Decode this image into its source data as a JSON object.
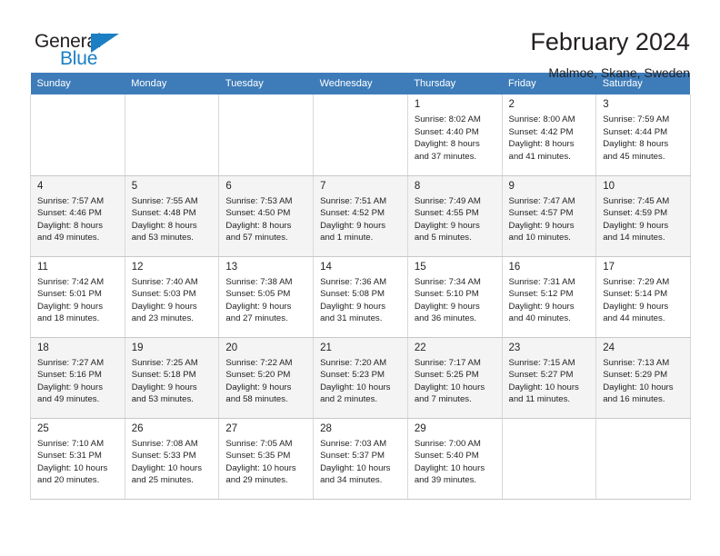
{
  "brand": {
    "name_part1": "General",
    "name_part2": "Blue",
    "mark_icon": "triangle-flag-icon",
    "accent_color": "#1c7fc4"
  },
  "header": {
    "title": "February 2024",
    "subtitle": "Malmoe, Skane, Sweden"
  },
  "calendar": {
    "header_bg": "#3e7cb9",
    "weekdays": [
      "Sunday",
      "Monday",
      "Tuesday",
      "Wednesday",
      "Thursday",
      "Friday",
      "Saturday"
    ],
    "weeks": [
      [
        {
          "day": "",
          "sunrise": "",
          "sunset": "",
          "daylight_line1": "",
          "daylight_line2": ""
        },
        {
          "day": "",
          "sunrise": "",
          "sunset": "",
          "daylight_line1": "",
          "daylight_line2": ""
        },
        {
          "day": "",
          "sunrise": "",
          "sunset": "",
          "daylight_line1": "",
          "daylight_line2": ""
        },
        {
          "day": "",
          "sunrise": "",
          "sunset": "",
          "daylight_line1": "",
          "daylight_line2": ""
        },
        {
          "day": "1",
          "sunrise": "Sunrise: 8:02 AM",
          "sunset": "Sunset: 4:40 PM",
          "daylight_line1": "Daylight: 8 hours",
          "daylight_line2": "and 37 minutes."
        },
        {
          "day": "2",
          "sunrise": "Sunrise: 8:00 AM",
          "sunset": "Sunset: 4:42 PM",
          "daylight_line1": "Daylight: 8 hours",
          "daylight_line2": "and 41 minutes."
        },
        {
          "day": "3",
          "sunrise": "Sunrise: 7:59 AM",
          "sunset": "Sunset: 4:44 PM",
          "daylight_line1": "Daylight: 8 hours",
          "daylight_line2": "and 45 minutes."
        }
      ],
      [
        {
          "day": "4",
          "sunrise": "Sunrise: 7:57 AM",
          "sunset": "Sunset: 4:46 PM",
          "daylight_line1": "Daylight: 8 hours",
          "daylight_line2": "and 49 minutes."
        },
        {
          "day": "5",
          "sunrise": "Sunrise: 7:55 AM",
          "sunset": "Sunset: 4:48 PM",
          "daylight_line1": "Daylight: 8 hours",
          "daylight_line2": "and 53 minutes."
        },
        {
          "day": "6",
          "sunrise": "Sunrise: 7:53 AM",
          "sunset": "Sunset: 4:50 PM",
          "daylight_line1": "Daylight: 8 hours",
          "daylight_line2": "and 57 minutes."
        },
        {
          "day": "7",
          "sunrise": "Sunrise: 7:51 AM",
          "sunset": "Sunset: 4:52 PM",
          "daylight_line1": "Daylight: 9 hours",
          "daylight_line2": "and 1 minute."
        },
        {
          "day": "8",
          "sunrise": "Sunrise: 7:49 AM",
          "sunset": "Sunset: 4:55 PM",
          "daylight_line1": "Daylight: 9 hours",
          "daylight_line2": "and 5 minutes."
        },
        {
          "day": "9",
          "sunrise": "Sunrise: 7:47 AM",
          "sunset": "Sunset: 4:57 PM",
          "daylight_line1": "Daylight: 9 hours",
          "daylight_line2": "and 10 minutes."
        },
        {
          "day": "10",
          "sunrise": "Sunrise: 7:45 AM",
          "sunset": "Sunset: 4:59 PM",
          "daylight_line1": "Daylight: 9 hours",
          "daylight_line2": "and 14 minutes."
        }
      ],
      [
        {
          "day": "11",
          "sunrise": "Sunrise: 7:42 AM",
          "sunset": "Sunset: 5:01 PM",
          "daylight_line1": "Daylight: 9 hours",
          "daylight_line2": "and 18 minutes."
        },
        {
          "day": "12",
          "sunrise": "Sunrise: 7:40 AM",
          "sunset": "Sunset: 5:03 PM",
          "daylight_line1": "Daylight: 9 hours",
          "daylight_line2": "and 23 minutes."
        },
        {
          "day": "13",
          "sunrise": "Sunrise: 7:38 AM",
          "sunset": "Sunset: 5:05 PM",
          "daylight_line1": "Daylight: 9 hours",
          "daylight_line2": "and 27 minutes."
        },
        {
          "day": "14",
          "sunrise": "Sunrise: 7:36 AM",
          "sunset": "Sunset: 5:08 PM",
          "daylight_line1": "Daylight: 9 hours",
          "daylight_line2": "and 31 minutes."
        },
        {
          "day": "15",
          "sunrise": "Sunrise: 7:34 AM",
          "sunset": "Sunset: 5:10 PM",
          "daylight_line1": "Daylight: 9 hours",
          "daylight_line2": "and 36 minutes."
        },
        {
          "day": "16",
          "sunrise": "Sunrise: 7:31 AM",
          "sunset": "Sunset: 5:12 PM",
          "daylight_line1": "Daylight: 9 hours",
          "daylight_line2": "and 40 minutes."
        },
        {
          "day": "17",
          "sunrise": "Sunrise: 7:29 AM",
          "sunset": "Sunset: 5:14 PM",
          "daylight_line1": "Daylight: 9 hours",
          "daylight_line2": "and 44 minutes."
        }
      ],
      [
        {
          "day": "18",
          "sunrise": "Sunrise: 7:27 AM",
          "sunset": "Sunset: 5:16 PM",
          "daylight_line1": "Daylight: 9 hours",
          "daylight_line2": "and 49 minutes."
        },
        {
          "day": "19",
          "sunrise": "Sunrise: 7:25 AM",
          "sunset": "Sunset: 5:18 PM",
          "daylight_line1": "Daylight: 9 hours",
          "daylight_line2": "and 53 minutes."
        },
        {
          "day": "20",
          "sunrise": "Sunrise: 7:22 AM",
          "sunset": "Sunset: 5:20 PM",
          "daylight_line1": "Daylight: 9 hours",
          "daylight_line2": "and 58 minutes."
        },
        {
          "day": "21",
          "sunrise": "Sunrise: 7:20 AM",
          "sunset": "Sunset: 5:23 PM",
          "daylight_line1": "Daylight: 10 hours",
          "daylight_line2": "and 2 minutes."
        },
        {
          "day": "22",
          "sunrise": "Sunrise: 7:17 AM",
          "sunset": "Sunset: 5:25 PM",
          "daylight_line1": "Daylight: 10 hours",
          "daylight_line2": "and 7 minutes."
        },
        {
          "day": "23",
          "sunrise": "Sunrise: 7:15 AM",
          "sunset": "Sunset: 5:27 PM",
          "daylight_line1": "Daylight: 10 hours",
          "daylight_line2": "and 11 minutes."
        },
        {
          "day": "24",
          "sunrise": "Sunrise: 7:13 AM",
          "sunset": "Sunset: 5:29 PM",
          "daylight_line1": "Daylight: 10 hours",
          "daylight_line2": "and 16 minutes."
        }
      ],
      [
        {
          "day": "25",
          "sunrise": "Sunrise: 7:10 AM",
          "sunset": "Sunset: 5:31 PM",
          "daylight_line1": "Daylight: 10 hours",
          "daylight_line2": "and 20 minutes."
        },
        {
          "day": "26",
          "sunrise": "Sunrise: 7:08 AM",
          "sunset": "Sunset: 5:33 PM",
          "daylight_line1": "Daylight: 10 hours",
          "daylight_line2": "and 25 minutes."
        },
        {
          "day": "27",
          "sunrise": "Sunrise: 7:05 AM",
          "sunset": "Sunset: 5:35 PM",
          "daylight_line1": "Daylight: 10 hours",
          "daylight_line2": "and 29 minutes."
        },
        {
          "day": "28",
          "sunrise": "Sunrise: 7:03 AM",
          "sunset": "Sunset: 5:37 PM",
          "daylight_line1": "Daylight: 10 hours",
          "daylight_line2": "and 34 minutes."
        },
        {
          "day": "29",
          "sunrise": "Sunrise: 7:00 AM",
          "sunset": "Sunset: 5:40 PM",
          "daylight_line1": "Daylight: 10 hours",
          "daylight_line2": "and 39 minutes."
        },
        {
          "day": "",
          "sunrise": "",
          "sunset": "",
          "daylight_line1": "",
          "daylight_line2": ""
        },
        {
          "day": "",
          "sunrise": "",
          "sunset": "",
          "daylight_line1": "",
          "daylight_line2": ""
        }
      ]
    ]
  }
}
